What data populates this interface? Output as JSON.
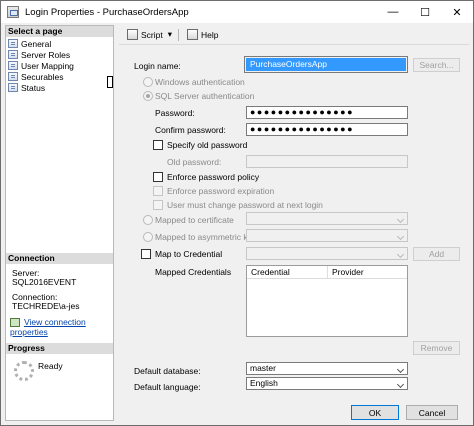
{
  "window": {
    "title": "Login Properties - PurchaseOrdersApp",
    "minimize": "—",
    "maximize": "☐",
    "close": "✕"
  },
  "left": {
    "select_page_header": "Select a page",
    "pages": [
      "General",
      "Server Roles",
      "User Mapping",
      "Securables",
      "Status"
    ],
    "connection_header": "Connection",
    "server_label": "Server:",
    "server_value": "SQL2016EVENT",
    "connection_label": "Connection:",
    "connection_value": "TECHREDE\\a-jes",
    "view_connection_link": "View connection properties",
    "progress_header": "Progress",
    "progress_status": "Ready"
  },
  "toolbar": {
    "script_label": "Script",
    "script_arrow": "▾",
    "help_label": "Help"
  },
  "form": {
    "login_name_label": "Login name:",
    "login_name_value": "PurchaseOrdersApp",
    "search_button": "Search...",
    "windows_auth": "Windows authentication",
    "sql_auth": "SQL Server authentication",
    "password_label": "Password:",
    "password_value": "●●●●●●●●●●●●●●●",
    "confirm_password_label": "Confirm password:",
    "confirm_password_value": "●●●●●●●●●●●●●●●",
    "specify_old_password": "Specify old password",
    "old_password_label": "Old password:",
    "enforce_policy": "Enforce password policy",
    "enforce_expiration": "Enforce password expiration",
    "must_change": "User must change password at next login",
    "mapped_certificate": "Mapped to certificate",
    "mapped_asym_key": "Mapped to asymmetric key",
    "map_credential": "Map to Credential",
    "add_button": "Add",
    "mapped_credentials_label": "Mapped Credentials",
    "grid_columns": [
      "Credential",
      "Provider"
    ],
    "remove_button": "Remove",
    "default_database_label": "Default database:",
    "default_database_value": "master",
    "default_language_label": "Default language:",
    "default_language_value": "English"
  },
  "footer": {
    "ok_button": "OK",
    "cancel_button": "Cancel"
  }
}
